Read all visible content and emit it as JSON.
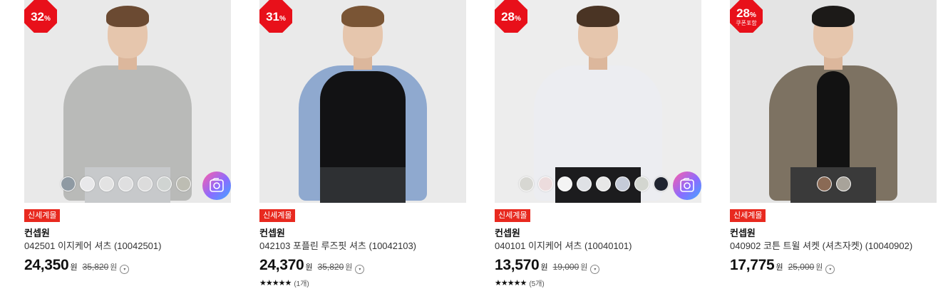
{
  "products": [
    {
      "discount": "32",
      "discount_unit": "%",
      "coupon_note": "",
      "tag": "신세계몰",
      "brand": "컨셉원",
      "name": "042501 이지케어 셔츠 (10042501)",
      "price": "24,350",
      "price_unit": "원",
      "original_price": "35,820",
      "original_unit": "원",
      "rating": "",
      "review_count": "",
      "swatches": [
        "#8f9aa3",
        "#e8e8ea",
        "#e3e3e3",
        "#dfdfe0",
        "#dcdcdc",
        "#d0d4d2",
        "#bdbdb3"
      ],
      "has_camera": true,
      "bg_color": "#e9e9e9",
      "colors": {
        "shirt": "#b9bab8",
        "pants": "#c7c9cb",
        "layer": ""
      }
    },
    {
      "discount": "31",
      "discount_unit": "%",
      "coupon_note": "",
      "tag": "신세계몰",
      "brand": "컨셉원",
      "name": "042103 포플린 루즈핏 셔츠 (10042103)",
      "price": "24,370",
      "price_unit": "원",
      "original_price": "35,820",
      "original_unit": "원",
      "rating": "★★★★★",
      "review_count": "(1개)",
      "swatches": [],
      "has_camera": false,
      "bg_color": "#eaeaea",
      "colors": {
        "shirt": "#8fa9cf",
        "pants": "#2e3033",
        "layer": "#121214"
      }
    },
    {
      "discount": "28",
      "discount_unit": "%",
      "coupon_note": "",
      "tag": "신세계몰",
      "brand": "컨셉원",
      "name": "040101 이지케어 셔츠 (10040101)",
      "price": "13,570",
      "price_unit": "원",
      "original_price": "19,000",
      "original_unit": "원",
      "rating": "★★★★★",
      "review_count": "(5개)",
      "swatches": [
        "#d7d7d2",
        "#ecdcdd",
        "#f4f4f4",
        "#dfe1e5",
        "#e7e7e7",
        "#c5cbd8",
        "#d3d6d0",
        "#1f2430"
      ],
      "has_camera": true,
      "bg_color": "#ededed",
      "colors": {
        "shirt": "#ecedf1",
        "pants": "#1c1c1e",
        "layer": ""
      }
    },
    {
      "discount": "28",
      "discount_unit": "%",
      "coupon_note": "쿠폰포함",
      "tag": "신세계몰",
      "brand": "컨셉원",
      "name": "040902 코튼 트윌 셔켓 (셔츠자켓) (10040902)",
      "price": "17,775",
      "price_unit": "원",
      "original_price": "25,000",
      "original_unit": "원",
      "rating": "",
      "review_count": "",
      "swatches": [
        "#8a6a55",
        "#a8a39a"
      ],
      "has_camera": false,
      "bg_color": "#e4e4e4",
      "colors": {
        "shirt": "#7d7262",
        "pants": "#3a3a3a",
        "layer": "#121212"
      }
    }
  ]
}
